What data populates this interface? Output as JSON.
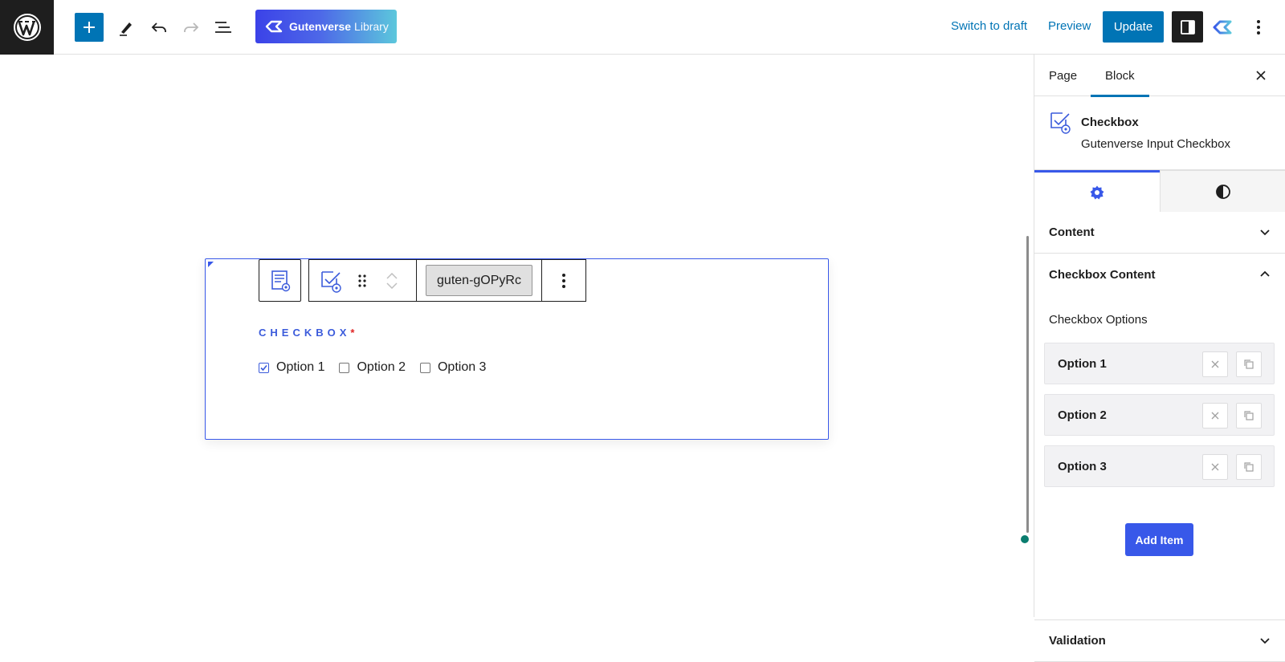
{
  "header": {
    "library_label_bold": "Gutenverse",
    "library_label_light": "Library",
    "switch_to_draft": "Switch to draft",
    "preview": "Preview",
    "update": "Update"
  },
  "canvas": {
    "block_id": "guten-gOPyRc",
    "field_label": "CHECKBOX",
    "required_mark": "*",
    "options": [
      {
        "label": "Option 1",
        "checked": true
      },
      {
        "label": "Option 2",
        "checked": false
      },
      {
        "label": "Option 3",
        "checked": false
      }
    ]
  },
  "sidebar": {
    "tabs": {
      "page": "Page",
      "block": "Block"
    },
    "block_title": "Checkbox",
    "block_description": "Gutenverse Input Checkbox",
    "panels": {
      "content": "Content",
      "checkbox_content": "Checkbox Content",
      "validation": "Validation"
    },
    "checkbox_options_title": "Checkbox Options",
    "option_items": [
      "Option 1",
      "Option 2",
      "Option 3"
    ],
    "add_item": "Add Item"
  },
  "colors": {
    "wp_blue": "#0074b5",
    "gutenverse_blue": "#3858e9",
    "required_red": "#e02424"
  }
}
